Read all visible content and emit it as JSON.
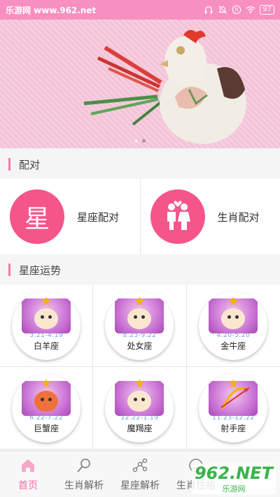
{
  "statusbar": {
    "site": "乐游网 www.962.net",
    "battery": "97"
  },
  "banner": {
    "dots": 2,
    "active_index": 1
  },
  "sections": {
    "pair": "配对",
    "fortune": "星座运势"
  },
  "pairs": [
    {
      "icon_text": "星",
      "label": "星座配对",
      "color": "#f5568a"
    },
    {
      "icon_text": "",
      "label": "生肖配对",
      "color": "#f5568a"
    }
  ],
  "signs": [
    {
      "date": "3.21-4.19",
      "name": "白羊座"
    },
    {
      "date": "8.23-9.22",
      "name": "处女座"
    },
    {
      "date": "4.20-5.20",
      "name": "金牛座"
    },
    {
      "date": "6.22-7.22",
      "name": "巨蟹座"
    },
    {
      "date": "12.22-1.19",
      "name": "魔羯座"
    },
    {
      "date": "11.23-12.22",
      "name": "射手座"
    }
  ],
  "tabs": [
    {
      "label": "首页",
      "icon": "home-icon",
      "active": true
    },
    {
      "label": "生肖解析",
      "icon": "search-icon",
      "active": false
    },
    {
      "label": "星座解析",
      "icon": "constellation-icon",
      "active": false
    },
    {
      "label": "生肖性格",
      "icon": "smile-icon",
      "active": false
    },
    {
      "label": "",
      "icon": "grid-icon",
      "active": false
    }
  ],
  "watermark": {
    "big": "962.NET",
    "small": "乐游网"
  },
  "colors": {
    "accent": "#f06ea7",
    "statusbar": "#f78fc0",
    "pair_circle": "#f5568a"
  }
}
